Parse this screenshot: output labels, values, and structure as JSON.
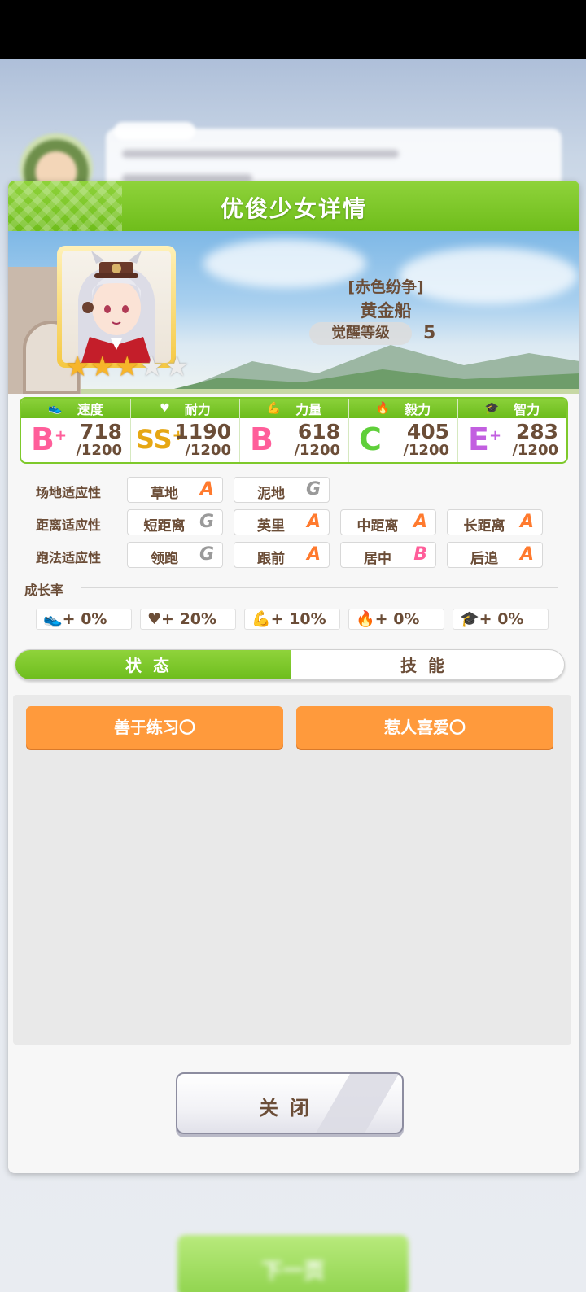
{
  "background": {
    "next_button_label": "下一页"
  },
  "panel": {
    "title": "优俊少女详情"
  },
  "character": {
    "epithet": "[赤色纷争]",
    "name": "黄金船",
    "awaken_label": "觉醒等级",
    "awaken_level": "5",
    "stars_total": 5,
    "stars_filled": 3
  },
  "stats": [
    {
      "name": "速度",
      "icon": "shoe-icon",
      "grade": "B",
      "plus": "+",
      "value": "718",
      "max": "/1200",
      "color": "#ff5e9a"
    },
    {
      "name": "耐力",
      "icon": "heart-icon",
      "grade": "SS",
      "plus": "+",
      "value": "1190",
      "max": "/1200",
      "color": "#e6a713"
    },
    {
      "name": "力量",
      "icon": "muscle-icon",
      "grade": "B",
      "plus": "",
      "value": "618",
      "max": "/1200",
      "color": "#ff5e9a"
    },
    {
      "name": "毅力",
      "icon": "flame-icon",
      "grade": "C",
      "plus": "",
      "value": "405",
      "max": "/1200",
      "color": "#5fcf3a"
    },
    {
      "name": "智力",
      "icon": "grad-cap-icon",
      "grade": "E",
      "plus": "+",
      "value": "283",
      "max": "/1200",
      "color": "#c25fe0"
    }
  ],
  "aptitude": {
    "track": {
      "label": "场地适应性",
      "items": [
        {
          "name": "草地",
          "grade": "A"
        },
        {
          "name": "泥地",
          "grade": "G"
        }
      ]
    },
    "distance": {
      "label": "距离适应性",
      "items": [
        {
          "name": "短距离",
          "grade": "G"
        },
        {
          "name": "英里",
          "grade": "A"
        },
        {
          "name": "中距离",
          "grade": "A"
        },
        {
          "name": "长距离",
          "grade": "A"
        }
      ]
    },
    "style": {
      "label": "跑法适应性",
      "items": [
        {
          "name": "领跑",
          "grade": "G"
        },
        {
          "name": "跟前",
          "grade": "A"
        },
        {
          "name": "居中",
          "grade": "B"
        },
        {
          "name": "后追",
          "grade": "A"
        }
      ]
    }
  },
  "growth": {
    "title": "成长率",
    "items": [
      {
        "icon": "shoe-icon",
        "value": "+ 0%"
      },
      {
        "icon": "heart-icon",
        "value": "+ 20%"
      },
      {
        "icon": "muscle-icon",
        "value": "+ 10%"
      },
      {
        "icon": "flame-icon",
        "value": "+ 0%"
      },
      {
        "icon": "grad-cap-icon",
        "value": "+ 0%"
      }
    ]
  },
  "tabs": {
    "status": "状态",
    "skills": "技能"
  },
  "traits": [
    "善于练习〇",
    "惹人喜爱〇"
  ],
  "close_label": "关闭",
  "grade_colors": {
    "A": "#ff7a2e",
    "B": "#ff5e9a",
    "G": "#9a9a9a"
  }
}
